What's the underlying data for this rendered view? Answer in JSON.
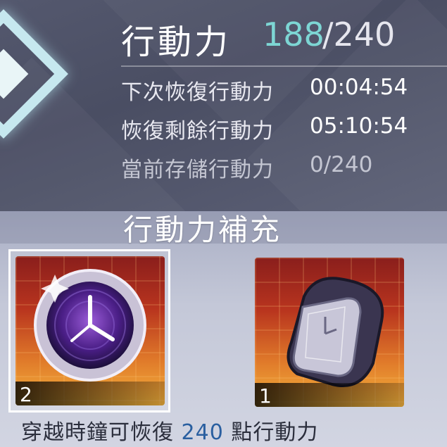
{
  "header": {
    "title": "行動力",
    "current": "188",
    "max_text": "/240"
  },
  "stats": [
    {
      "label": "下次恢復行動力",
      "value": "00:04:54"
    },
    {
      "label": "恢復剩餘行動力",
      "value": "05:10:54"
    },
    {
      "label": "當前存儲行動力",
      "value": "0/240"
    }
  ],
  "refill": {
    "title": "行動力補充",
    "items": [
      {
        "name": "time-clock",
        "count": "2",
        "selected": true
      },
      {
        "name": "wristwatch",
        "count": "1",
        "selected": false
      }
    ],
    "footer": {
      "prefix": "穿越時鐘可恢復 ",
      "amount": "240",
      "suffix": " 點行動力"
    }
  },
  "colors": {
    "accent": "#7dd6d4",
    "highlight": "#2a5fa0"
  }
}
